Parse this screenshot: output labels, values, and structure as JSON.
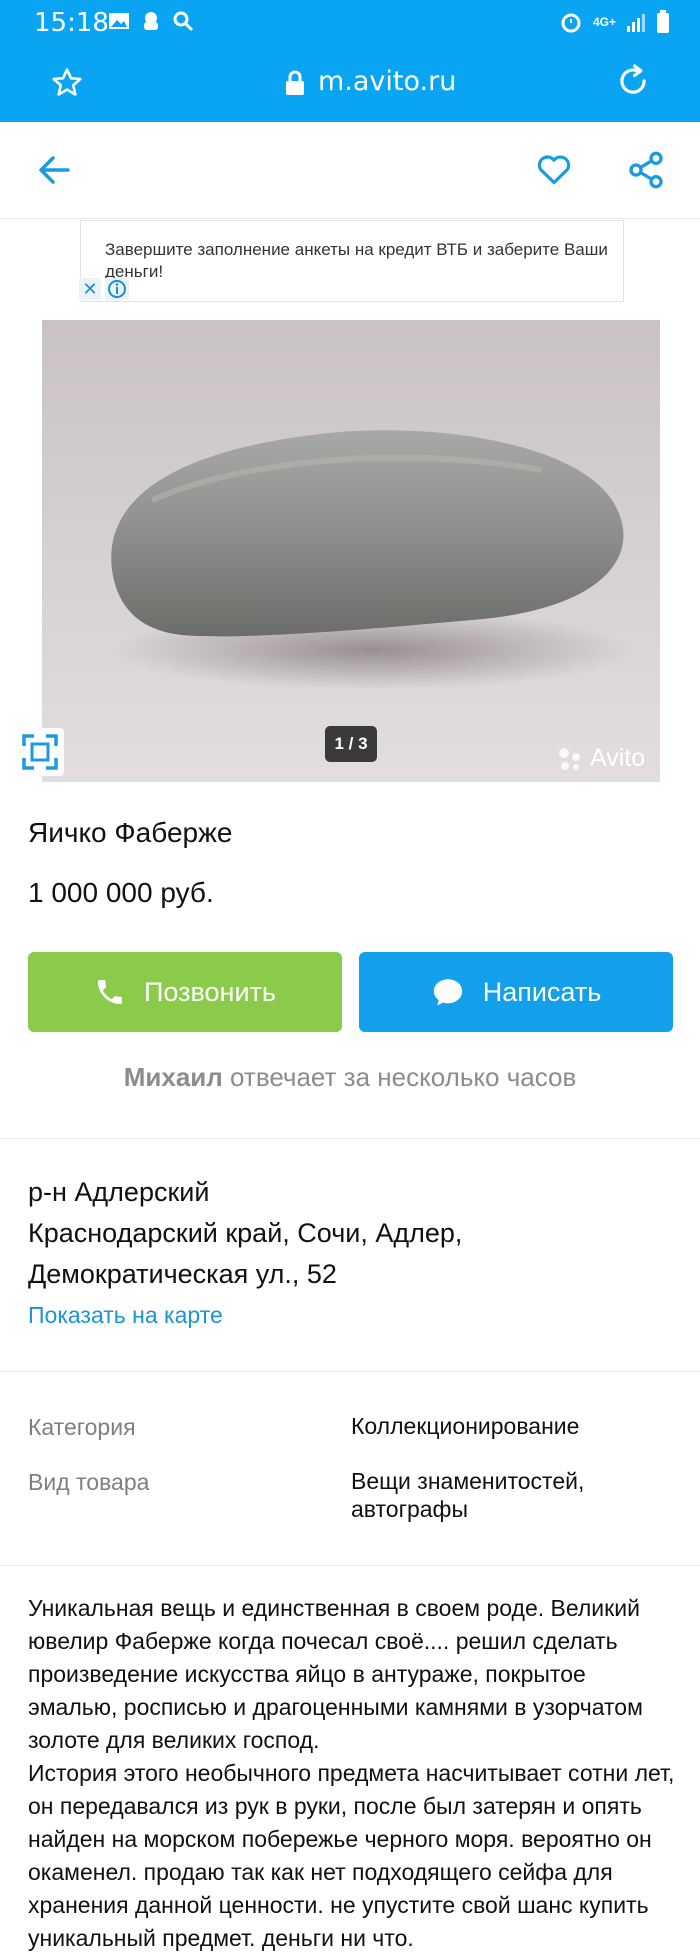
{
  "status_bar": {
    "time": "15:18",
    "network": "4G+"
  },
  "browser": {
    "url": "m.avito.ru"
  },
  "ad": {
    "text": "Завершите заполнение анкеты на кредит ВТБ и заберите Ваши деньги!"
  },
  "gallery": {
    "counter": "1 / 3",
    "watermark": "Avito"
  },
  "item": {
    "title": "Яичко Фаберже",
    "price": "1 000 000 руб."
  },
  "actions": {
    "call_label": "Позвонить",
    "write_label": "Написать"
  },
  "seller": {
    "name": "Михаил",
    "response": "отвечает за несколько часов"
  },
  "address": {
    "district": "р-н Адлерский",
    "line1": "Краснодарский край, Сочи, Адлер,",
    "line2": "Демократическая ул., 52",
    "map_link": "Показать на карте"
  },
  "params": [
    {
      "label": "Категория",
      "value": "Коллекционирование"
    },
    {
      "label": "Вид товара",
      "value": "Вещи знаменитостей, автографы"
    }
  ],
  "description": {
    "p1": "Уникальная вещь и единственная в своем роде. Великий ювелир Фаберже когда почесал своё.... решил сделать произведение искусства яйцо в антураже, покрытое эмалью, росписью и драгоценными камнями в узорчатом золоте для великих господ.",
    "p2": "История этого необычного предмета насчитывает сотни лет, он передавался из рук в руки, после был затерян и опять найден на морском побережье черного моря. вероятно он окаменел. продаю так как нет подходящего сейфа для хранения данной ценности. не упустите свой шанс купить уникальный предмет. деньги ни что."
  },
  "colors": {
    "accent": "#0aa5f2",
    "call": "#8acc4a",
    "write": "#12a0ea",
    "link": "#1996d6"
  }
}
